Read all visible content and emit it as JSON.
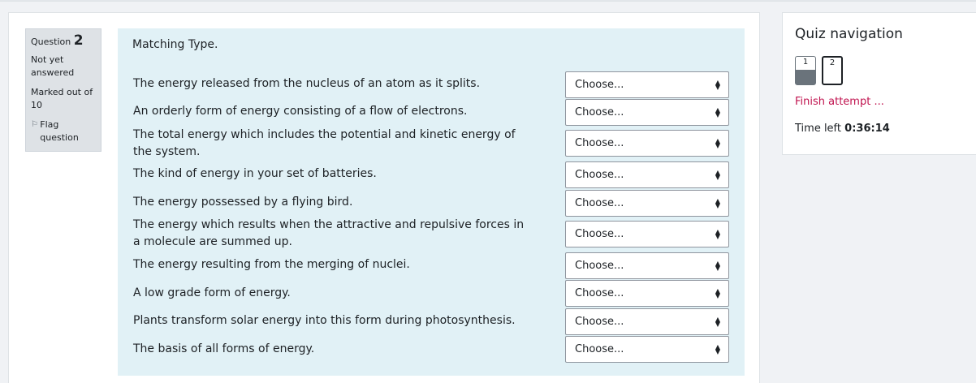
{
  "question_info": {
    "question_label": "Question",
    "question_number": "2",
    "state": "Not yet answered",
    "grade": "Marked out of 10",
    "flag_label": "Flag question"
  },
  "question": {
    "prompt": "Matching Type.",
    "rows": [
      {
        "text": "The energy released from the nucleus of an atom as it splits.",
        "selected": "Choose..."
      },
      {
        "text": "An orderly form of energy consisting of a flow of electrons.",
        "selected": "Choose..."
      },
      {
        "text": "The total energy which includes the potential and kinetic energy of the system.",
        "selected": "Choose..."
      },
      {
        "text": "The kind of energy in your set of batteries.",
        "selected": "Choose..."
      },
      {
        "text": "The energy possessed by a flying bird.",
        "selected": "Choose..."
      },
      {
        "text": "The energy which results when the attractive and repulsive forces in a molecule are summed up.",
        "selected": "Choose..."
      },
      {
        "text": "The energy resulting from the merging of nuclei.",
        "selected": "Choose..."
      },
      {
        "text": "A low grade form of energy.",
        "selected": "Choose..."
      },
      {
        "text": "Plants transform solar energy into this form during photosynthesis.",
        "selected": "Choose..."
      },
      {
        "text": "The basis of all forms of energy.",
        "selected": "Choose..."
      }
    ]
  },
  "quiz_nav": {
    "title": "Quiz navigation",
    "buttons": [
      {
        "label": "1",
        "state": "answered-partial"
      },
      {
        "label": "2",
        "state": "current"
      }
    ],
    "finish_label": "Finish attempt ...",
    "time_left_label": "Time left",
    "time_left_value": "0:36:14"
  },
  "colors": {
    "content_bg": "#e1f1f6",
    "info_bg": "#dee2e6",
    "link_accent": "#c0124e"
  }
}
